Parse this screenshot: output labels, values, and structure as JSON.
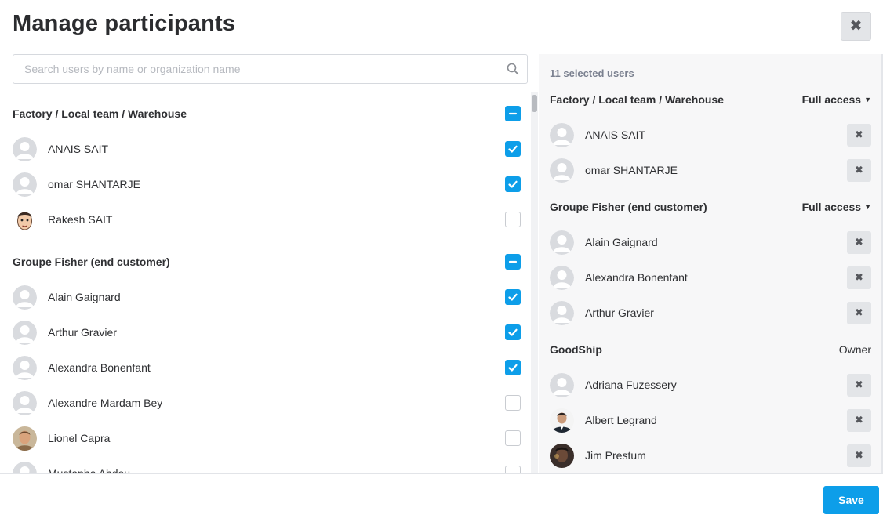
{
  "modal": {
    "title": "Manage participants",
    "close_icon": "close-icon"
  },
  "search": {
    "placeholder": "Search users by name or organization name",
    "value": "",
    "icon": "search-icon"
  },
  "left": {
    "groups": [
      {
        "name": "Factory / Local team / Warehouse",
        "state": "partial",
        "users": [
          {
            "name": "ANAIS SAIT",
            "checked": true,
            "avatar": "default-avatar"
          },
          {
            "name": "omar SHANTARJE",
            "checked": true,
            "avatar": "default-avatar"
          },
          {
            "name": "Rakesh SAIT",
            "checked": false,
            "avatar": "cartoon-face-avatar"
          }
        ]
      },
      {
        "name": "Groupe Fisher (end customer)",
        "state": "partial",
        "users": [
          {
            "name": "Alain Gaignard",
            "checked": true,
            "avatar": "default-avatar"
          },
          {
            "name": "Arthur Gravier",
            "checked": true,
            "avatar": "default-avatar"
          },
          {
            "name": "Alexandra Bonenfant",
            "checked": true,
            "avatar": "default-avatar"
          },
          {
            "name": "Alexandre Mardam Bey",
            "checked": false,
            "avatar": "default-avatar"
          },
          {
            "name": "Lionel Capra",
            "checked": false,
            "avatar": "photo-avatar"
          },
          {
            "name": "Mustapha Abdou",
            "checked": false,
            "avatar": "default-avatar"
          }
        ]
      }
    ]
  },
  "right": {
    "selected_count_label": "11 selected users",
    "groups": [
      {
        "name": "Factory / Local team / Warehouse",
        "access": "Full access",
        "users": [
          {
            "name": "ANAIS SAIT",
            "avatar": "default-avatar"
          },
          {
            "name": "omar SHANTARJE",
            "avatar": "default-avatar"
          }
        ]
      },
      {
        "name": "Groupe Fisher (end customer)",
        "access": "Full access",
        "users": [
          {
            "name": "Alain Gaignard",
            "avatar": "default-avatar"
          },
          {
            "name": "Alexandra Bonenfant",
            "avatar": "default-avatar"
          },
          {
            "name": "Arthur Gravier",
            "avatar": "default-avatar"
          }
        ]
      },
      {
        "name": "GoodShip",
        "access": "Owner",
        "users": [
          {
            "name": "Adriana Fuzessery",
            "avatar": "default-avatar"
          },
          {
            "name": "Albert Legrand",
            "avatar": "photo-avatar"
          },
          {
            "name": "Jim Prestum",
            "avatar": "photo-avatar"
          }
        ]
      }
    ]
  },
  "footer": {
    "save_label": "Save"
  },
  "colors": {
    "accent": "#0d9ee9",
    "button_gray": "#e3e5e8",
    "panel_bg": "#f7f7f8"
  }
}
